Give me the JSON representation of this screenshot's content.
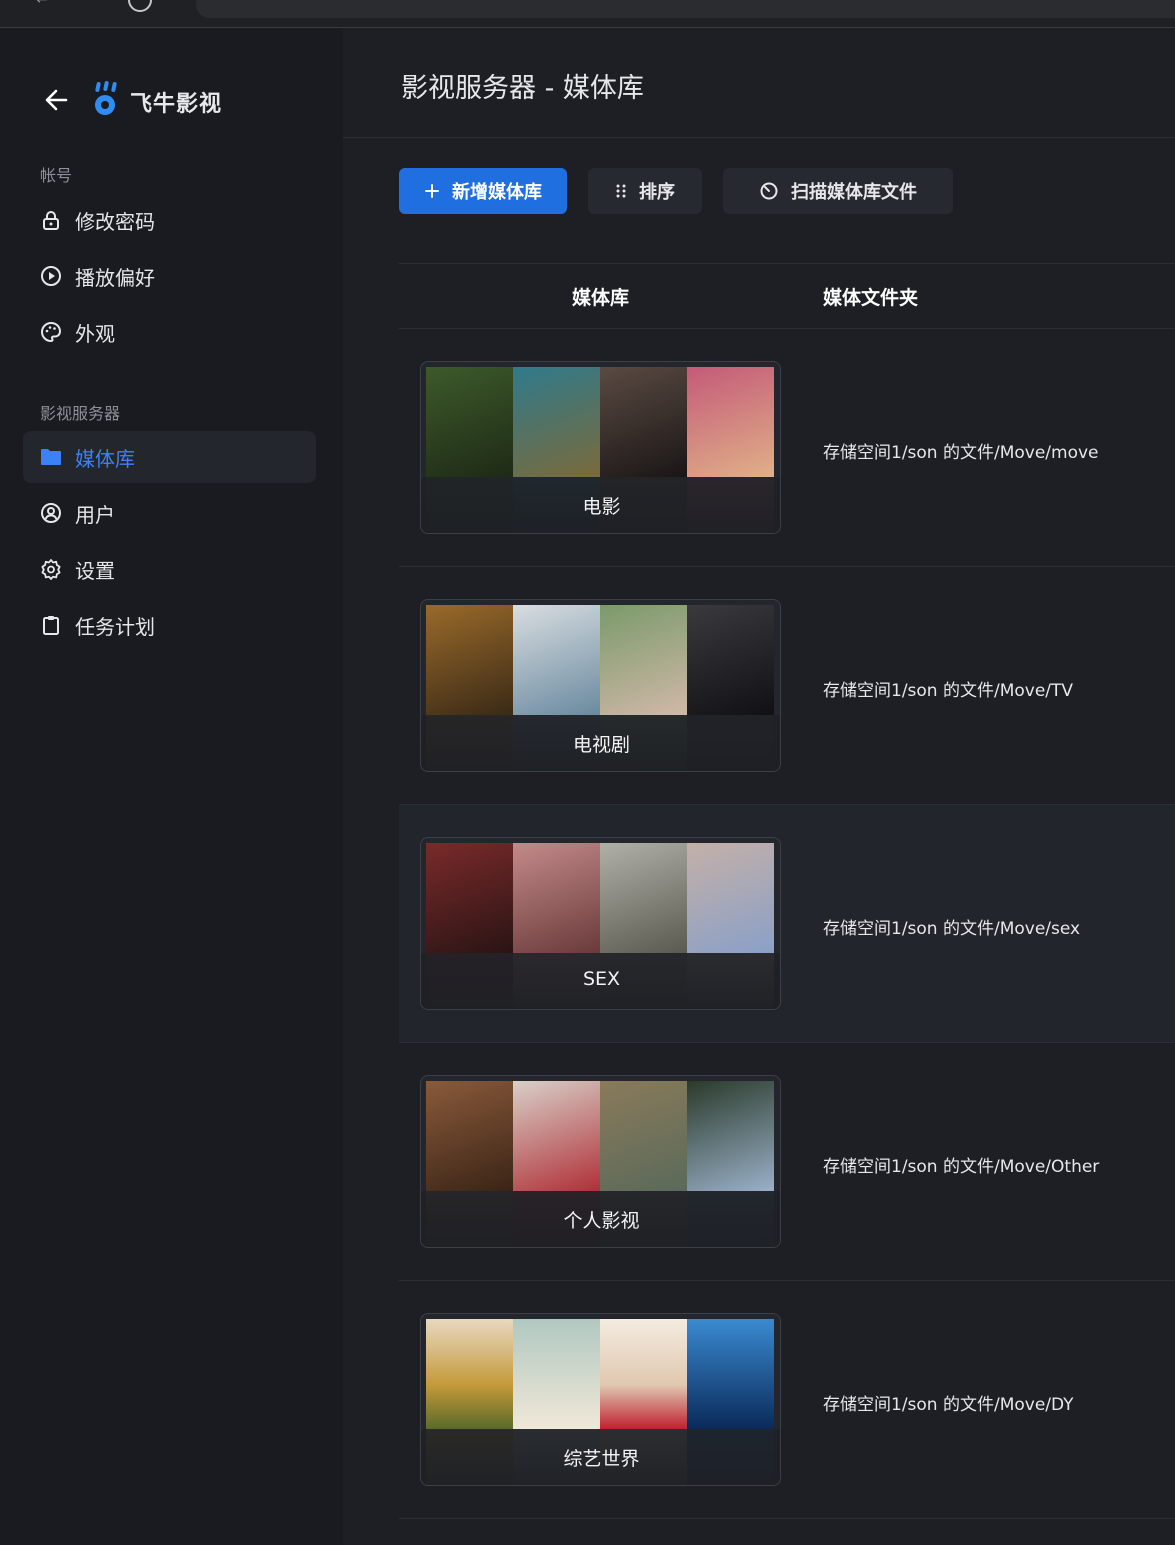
{
  "app": {
    "brand": "飞牛影视"
  },
  "sidebar": {
    "account_label": "帐号",
    "account_items": [
      {
        "label": "修改密码",
        "icon": "lock-icon"
      },
      {
        "label": "播放偏好",
        "icon": "play-circle-icon"
      },
      {
        "label": "外观",
        "icon": "palette-icon"
      }
    ],
    "server_label": "影视服务器",
    "server_items": [
      {
        "label": "媒体库",
        "icon": "folder-icon",
        "active": true
      },
      {
        "label": "用户",
        "icon": "user-circle-icon"
      },
      {
        "label": "设置",
        "icon": "gear-icon"
      },
      {
        "label": "任务计划",
        "icon": "clipboard-icon"
      }
    ]
  },
  "main": {
    "title": "影视服务器 - 媒体库",
    "toolbar": {
      "add_label": "新增媒体库",
      "sort_label": "排序",
      "scan_label": "扫描媒体库文件"
    },
    "table": {
      "headers": [
        "媒体库",
        "媒体文件夹"
      ],
      "rows": [
        {
          "name": "电影",
          "folder": "存储空间1/son 的文件/Move/move",
          "colors": [
            "#3d5a2a",
            "#2f7a8c",
            "#5a4a42",
            "#c45a78"
          ]
        },
        {
          "name": "电视剧",
          "folder": "存储空间1/son 的文件/Move/TV",
          "colors": [
            "#9a6a2a",
            "#6a8aa0",
            "#7a9a6a",
            "#3a3a3e"
          ]
        },
        {
          "name": "SEX",
          "folder": "存储空间1/son 的文件/Move/sex",
          "colors": [
            "#7a2a2a",
            "#c48a8a",
            "#8a8a7a",
            "#c4b0a8"
          ]
        },
        {
          "name": "个人影视",
          "folder": "存储空间1/son 的文件/Move/Other",
          "colors": [
            "#8a5a3a",
            "#b03038",
            "#8a7a5a",
            "#4a6a8a"
          ]
        },
        {
          "name": "综艺世界",
          "folder": "存储空间1/son 的文件/Move/DY",
          "colors": [
            "#c49a3a",
            "#b0c8c0",
            "#e0c8b0",
            "#1a5a9a"
          ]
        }
      ]
    }
  },
  "colors": {
    "accent": "#1f6fe0",
    "active_text": "#3b82f6"
  }
}
